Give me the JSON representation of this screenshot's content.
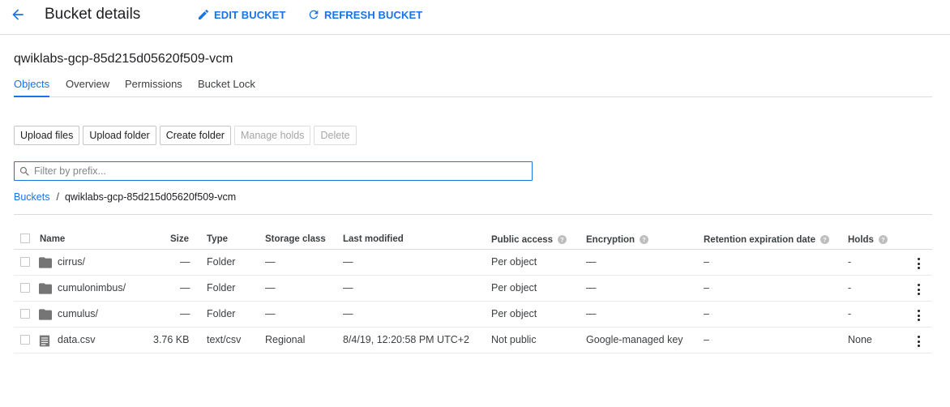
{
  "header": {
    "title": "Bucket details",
    "edit_label": "EDIT BUCKET",
    "refresh_label": "REFRESH BUCKET"
  },
  "bucket_name": "qwiklabs-gcp-85d215d05620f509-vcm",
  "tabs": [
    {
      "label": "Objects",
      "active": true
    },
    {
      "label": "Overview",
      "active": false
    },
    {
      "label": "Permissions",
      "active": false
    },
    {
      "label": "Bucket Lock",
      "active": false
    }
  ],
  "toolbar": {
    "upload_files": "Upload files",
    "upload_folder": "Upload folder",
    "create_folder": "Create folder",
    "manage_holds": "Manage holds",
    "delete": "Delete"
  },
  "filter": {
    "placeholder": "Filter by prefix...",
    "value": ""
  },
  "breadcrumb": {
    "root": "Buckets",
    "separator": "/",
    "current": "qwiklabs-gcp-85d215d05620f509-vcm"
  },
  "table": {
    "headers": {
      "name": "Name",
      "size": "Size",
      "type": "Type",
      "storage_class": "Storage class",
      "last_modified": "Last modified",
      "public_access": "Public access",
      "encryption": "Encryption",
      "retention": "Retention expiration date",
      "holds": "Holds"
    },
    "rows": [
      {
        "icon": "folder-icon",
        "name": "cirrus/",
        "size": "—",
        "type": "Folder",
        "storage_class": "—",
        "last_modified": "—",
        "public_access": "Per object",
        "encryption": "—",
        "retention": "–",
        "holds": "-"
      },
      {
        "icon": "folder-icon",
        "name": "cumulonimbus/",
        "size": "—",
        "type": "Folder",
        "storage_class": "—",
        "last_modified": "—",
        "public_access": "Per object",
        "encryption": "—",
        "retention": "–",
        "holds": "-"
      },
      {
        "icon": "folder-icon",
        "name": "cumulus/",
        "size": "—",
        "type": "Folder",
        "storage_class": "—",
        "last_modified": "—",
        "public_access": "Per object",
        "encryption": "—",
        "retention": "–",
        "holds": "-"
      },
      {
        "icon": "file-icon",
        "name": "data.csv",
        "size": "3.76 KB",
        "type": "text/csv",
        "storage_class": "Regional",
        "last_modified": "8/4/19, 12:20:58 PM UTC+2",
        "public_access": "Not public",
        "encryption": "Google-managed key",
        "retention": "–",
        "holds": "None"
      }
    ]
  },
  "colors": {
    "accent": "#1a73e8",
    "text": "#202124",
    "divider": "#dadce0",
    "icon_grey": "#757575"
  }
}
